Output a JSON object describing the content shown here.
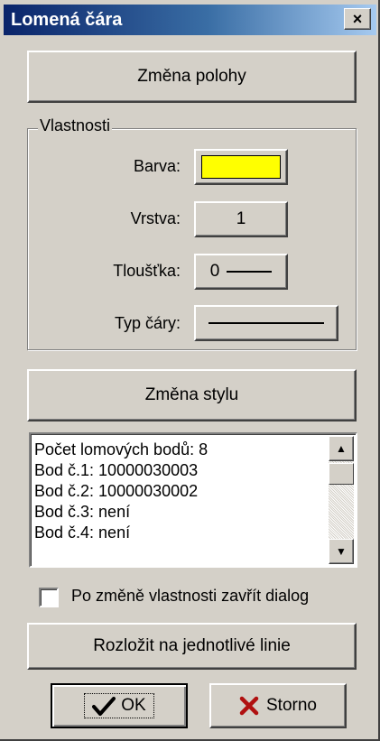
{
  "window": {
    "title": "Lomená čára",
    "close_label": "×"
  },
  "buttons": {
    "change_position": "Změna polohy",
    "change_style": "Změna stylu",
    "split_lines": "Rozložit na jednotlivé linie",
    "ok": "OK",
    "cancel": "Storno"
  },
  "properties": {
    "group_title": "Vlastnosti",
    "color_label": "Barva:",
    "color_value": "#ffff00",
    "layer_label": "Vrstva:",
    "layer_value": "1",
    "thickness_label": "Tloušťka:",
    "thickness_value": "0",
    "line_type_label": "Typ čáry:"
  },
  "info_list": {
    "items": [
      "Počet lomových bodů: 8",
      "Bod č.1: 10000030003",
      "Bod č.2: 10000030002",
      "Bod č.3: není",
      "Bod č.4: není"
    ]
  },
  "options": {
    "close_after_change_label": "Po změně vlastnosti zavřít dialog",
    "close_after_change_checked": false
  },
  "icons": {
    "ok": "checkmark-icon",
    "cancel": "red-x-icon",
    "close": "close-icon",
    "scroll_up": "scroll-up-arrow-icon",
    "scroll_down": "scroll-down-arrow-icon"
  }
}
